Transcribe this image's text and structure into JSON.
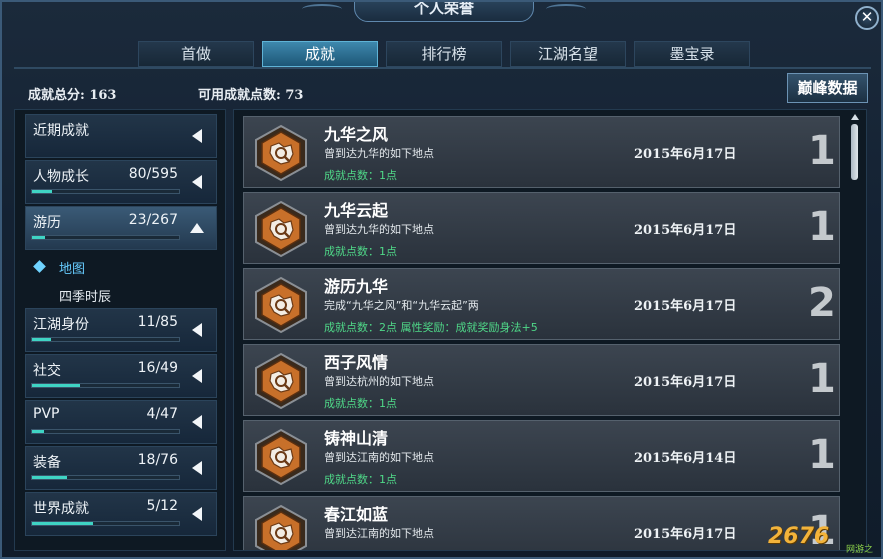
{
  "window": {
    "title": "个人荣誉",
    "close_symbol": "✕"
  },
  "tabs": [
    {
      "label": "首做"
    },
    {
      "label": "成就"
    },
    {
      "label": "排行榜"
    },
    {
      "label": "江湖名望"
    },
    {
      "label": "墨宝录"
    }
  ],
  "stats": {
    "total": "成就总分: 163",
    "available": "可用成就点数: 73"
  },
  "peak_button": "巅峰数据",
  "categories": [
    {
      "name": "近期成就",
      "count": "",
      "progress": null,
      "open": false
    },
    {
      "name": "人物成长",
      "count": "80/595",
      "progress": 0.134,
      "open": false
    },
    {
      "name": "游历",
      "count": "23/267",
      "progress": 0.086,
      "open": true
    },
    {
      "name": "江湖身份",
      "count": "11/85",
      "progress": 0.129,
      "open": false
    },
    {
      "name": "社交",
      "count": "16/49",
      "progress": 0.327,
      "open": false
    },
    {
      "name": "PVP",
      "count": "4/47",
      "progress": 0.085,
      "open": false
    },
    {
      "name": "装备",
      "count": "18/76",
      "progress": 0.237,
      "open": false
    },
    {
      "name": "世界成就",
      "count": "5/12",
      "progress": 0.417,
      "open": false
    }
  ],
  "subcategories": [
    {
      "label": "地图",
      "selected": true
    },
    {
      "label": "四季时辰",
      "selected": false
    }
  ],
  "achievements": [
    {
      "name": "九华之风",
      "desc": "曾到达九华的如下地点",
      "points": "成就点数：1点",
      "date": "2015年6月17日",
      "num": "1"
    },
    {
      "name": "九华云起",
      "desc": "曾到达九华的如下地点",
      "points": "成就点数：1点",
      "date": "2015年6月17日",
      "num": "1"
    },
    {
      "name": "游历九华",
      "desc": "完成“九华之风”和“九华云起”两",
      "points": "成就点数：2点 属性奖励：成就奖励身法+5",
      "date": "2015年6月17日",
      "num": "2"
    },
    {
      "name": "西子风情",
      "desc": "曾到达杭州的如下地点",
      "points": "成就点数：1点",
      "date": "2015年6月17日",
      "num": "1"
    },
    {
      "name": "铸神山清",
      "desc": "曾到达江南的如下地点",
      "points": "成就点数：1点",
      "date": "2015年6月14日",
      "num": "1"
    },
    {
      "name": "春江如蓝",
      "desc": "曾到达江南的如下地点",
      "points": "",
      "date": "2015年6月17日",
      "num": "1"
    }
  ],
  "watermark": {
    "text": "2676",
    "sub": "网游之家"
  },
  "colors": {
    "accent": "#3fd4c4",
    "points_green": "#4fd888",
    "tab_active": "#3e88ad",
    "badge_orange": "#c8702a"
  }
}
